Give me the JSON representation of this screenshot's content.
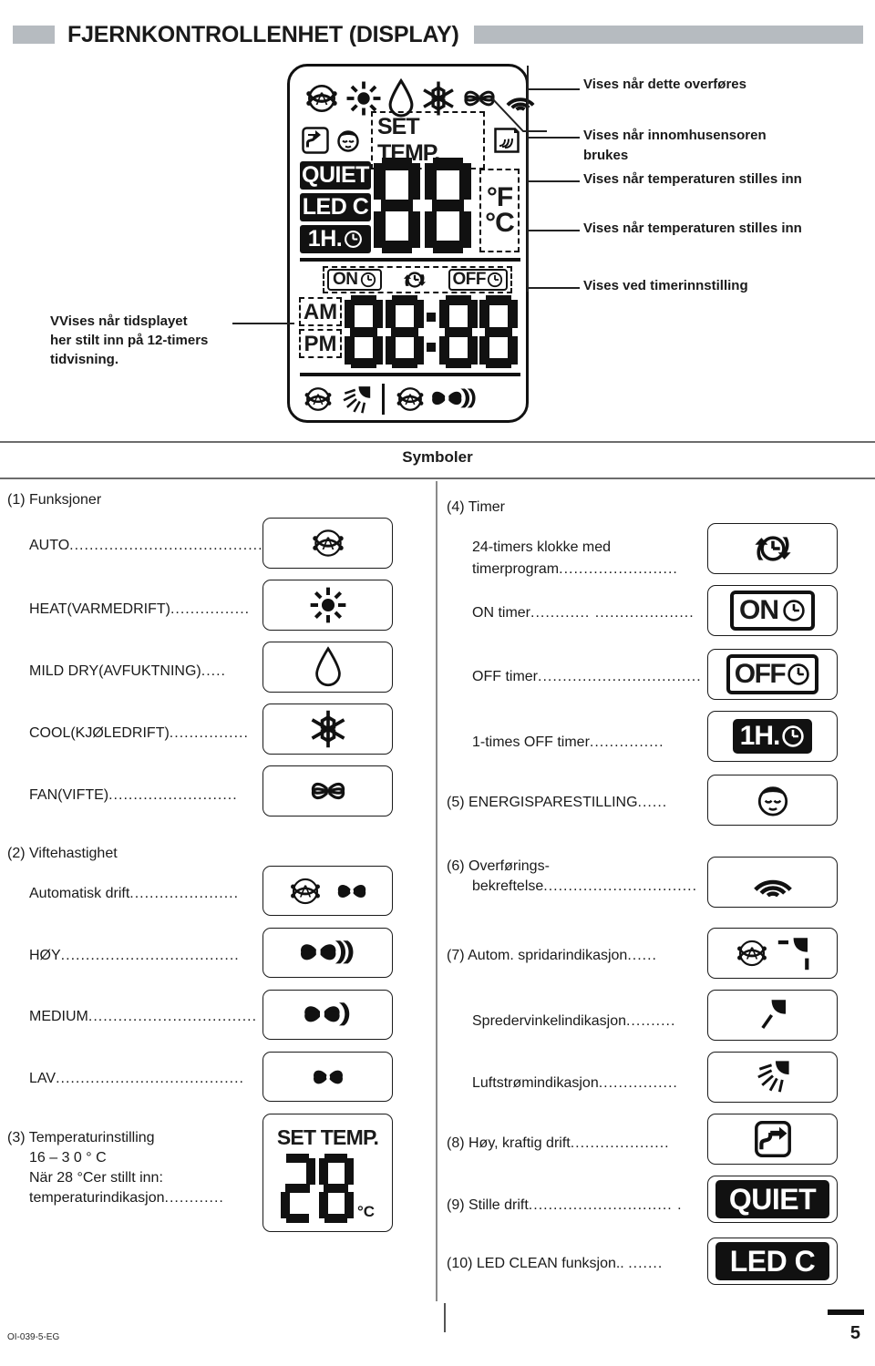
{
  "header": {
    "title": "FJERNKONTROLLENHET (DISPLAY)"
  },
  "lcd": {
    "set_temp_label": "SET TEMP.",
    "quiet": "QUIET",
    "led_c": "LED C",
    "one_hour": "1H.",
    "deg_f": "°F",
    "deg_c": "°C",
    "on_label": "ON",
    "off_label": "OFF",
    "am": "AM",
    "pm": "PM",
    "temp_digits": "88",
    "clock_digits": "88:88"
  },
  "callouts": {
    "left": "VVises når tidsplayet\nher stilt inn på 12-timers\ntidvisning.",
    "left_l1": "VVises når tidsplayet",
    "left_l2": "her stilt inn på 12-timers",
    "left_l3": "tidvisning.",
    "r1": "Vises når dette overføres",
    "r2_l1": "Vises når innomhusensoren",
    "r2_l2": "brukes",
    "r3": "Vises når temperaturen stilles inn",
    "r4": "Vises når temperaturen stilles inn",
    "r5": "Vises ved timerinnstilling"
  },
  "symboler": {
    "title": "Symboler"
  },
  "left_column": {
    "group1": "(1) Funksjoner",
    "items": [
      {
        "label": "AUTO",
        "dots": "........................................",
        "icon": "auto-circle-a-icon"
      },
      {
        "label": "HEAT(VARMEDRIFT)",
        "dots": "................",
        "icon": "sun-icon"
      },
      {
        "label": "MILD DRY(AVFUKTNING)",
        "dots": ".....",
        "icon": "water-drop-icon"
      },
      {
        "label": "COOL(KJØLEDRIFT)",
        "dots": "................",
        "icon": "snowflake-icon"
      },
      {
        "label": "FAN(VIFTE)",
        "dots": "..........................",
        "icon": "fan-icon"
      }
    ],
    "group2": "(2) Viftehastighet",
    "items2": [
      {
        "label": "Automatisk drift",
        "dots": "......................",
        "icon": "auto-fan-icon"
      },
      {
        "label": "HØY",
        "dots": "....................................",
        "icon": "fan-high-icon"
      },
      {
        "label": "MEDIUM",
        "dots": "..................................",
        "icon": "fan-medium-icon"
      },
      {
        "label": "LAV",
        "dots": "......................................",
        "icon": "fan-low-icon"
      }
    ],
    "group3_l1": "(3) Temperaturinstilling",
    "group3_l2": "16 – 3 0 ° C",
    "group3_l3": "När 28 °Cer stillt inn:",
    "group3_l4": "temperaturindikasjon",
    "group3_dots": "............",
    "group3_icon_label": "SET TEMP.",
    "group3_icon_value": "28",
    "group3_icon_unit": "°C"
  },
  "right_column": {
    "group4": "(4) Timer",
    "items4": [
      {
        "label_l1": "24-timers klokke med",
        "label_l2": "timerprogram",
        "dots": "........................",
        "icon": "clock-cycle-icon"
      },
      {
        "label_l1": "ON timer",
        "label_l2": "",
        "dots": "............    ....................",
        "icon": "on-timer-icon"
      },
      {
        "label_l1": "OFF timer",
        "label_l2": "",
        "dots": ".................................",
        "icon": "off-timer-icon"
      },
      {
        "label_l1": "1-times OFF timer",
        "label_l2": "",
        "dots": "...............",
        "icon": "one-hour-off-timer-icon"
      }
    ],
    "group5": "(5) ENERGISPARESTILLING",
    "group5_dots": "......",
    "group5_icon": "sleeping-face-icon",
    "group6_l1": "(6) Overførings-",
    "group6_l2": "bekreftelse",
    "group6_dots": "...............................",
    "group6_icon": "signal-wave-icon",
    "group7": "(7) Autom. spridarindikasjon",
    "group7_dots": "......",
    "group7_icon": "auto-louver-icon",
    "item_spreder": "Spredervinkelindikasjon",
    "item_spreder_dots": "..........",
    "item_spreder_icon": "louver-angle-icon",
    "item_luft": "Luftstrømindikasjon",
    "item_luft_dots": "................",
    "item_luft_icon": "airflow-icon",
    "group8": "(8) Høy, kraftig drift",
    "group8_dots": "....................",
    "group8_icon": "powerful-arrow-icon",
    "group9": "(9) Stille drift",
    "group9_dots": "............................. .",
    "group9_icon": "QUIET",
    "group10": "(10) LED CLEAN funksjon.. ",
    "group10_dots": ".......",
    "group10_icon": "LED C"
  },
  "footer": {
    "code": "OI-039-5-EG",
    "page": "5"
  }
}
